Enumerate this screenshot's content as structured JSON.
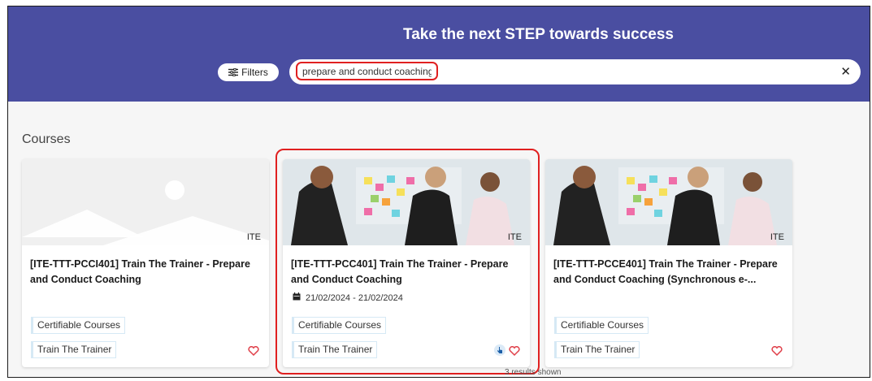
{
  "header": {
    "title": "Take the next STEP towards success",
    "filters_label": "Filters",
    "search_value": "prepare and conduct coaching"
  },
  "section": {
    "title": "Courses"
  },
  "courses": [
    {
      "provider": "ITE",
      "title": "[ITE-TTT-PCCI401] Train The Trainer - Prepare and Conduct Coaching",
      "date": "",
      "tags": [
        "Certifiable Courses",
        "Train The Trainer"
      ]
    },
    {
      "provider": "ITE",
      "title": "[ITE-TTT-PCC401] Train The Trainer - Prepare and Conduct Coaching",
      "date": "21/02/2024 - 21/02/2024",
      "tags": [
        "Certifiable Courses",
        "Train The Trainer"
      ]
    },
    {
      "provider": "ITE",
      "title": "[ITE-TTT-PCCE401] Train The Trainer - Prepare and Conduct Coaching (Synchronous e-...",
      "date": "",
      "tags": [
        "Certifiable Courses",
        "Train The Trainer"
      ]
    }
  ],
  "footer": {
    "results_text": "3 results shown"
  },
  "colors": {
    "hero_bg": "#4a4ea1",
    "highlight": "#e02020",
    "heart": "#e0404a",
    "tag_border": "#d6e9f5"
  },
  "icons": [
    "filter-sliders-icon",
    "close-icon",
    "calendar-icon",
    "heart-icon",
    "hand-pointer-icon"
  ]
}
